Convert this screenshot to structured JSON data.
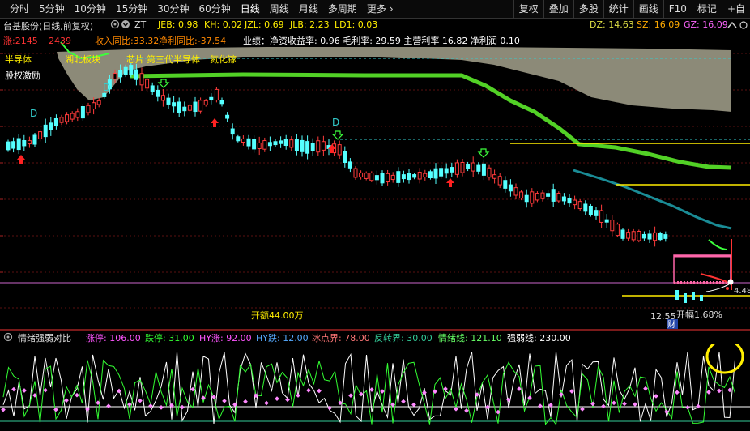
{
  "toolbar": {
    "tabs": [
      {
        "label": "分时"
      },
      {
        "label": "5分钟"
      },
      {
        "label": "10分钟"
      },
      {
        "label": "15分钟"
      },
      {
        "label": "30分钟"
      },
      {
        "label": "60分钟"
      },
      {
        "label": "日线"
      },
      {
        "label": "周线"
      },
      {
        "label": "月线"
      },
      {
        "label": "多周期"
      },
      {
        "label": "更多"
      }
    ],
    "more_arrow": "›",
    "right_buttons": [
      {
        "label": "复权"
      },
      {
        "label": "叠加"
      },
      {
        "label": "多股"
      },
      {
        "label": "统计"
      },
      {
        "label": "画线"
      },
      {
        "label": "F10"
      },
      {
        "label": "标记"
      },
      {
        "label": "+自"
      }
    ]
  },
  "header": {
    "stock_title": "台基股份(日线,前复权)",
    "zt_label": "ZT",
    "indicators": [
      {
        "label": "JEB: 0.98"
      },
      {
        "label": "KH: 0.02"
      },
      {
        "label": "JZL: 0.69"
      },
      {
        "label": "JLB: 2.23"
      },
      {
        "label": "LD1: 0.03"
      }
    ],
    "right_indicators": [
      {
        "label": "DZ: 14.63"
      },
      {
        "label": "SZ: 16.09"
      },
      {
        "label": "GZ: 16.09"
      }
    ]
  },
  "main": {
    "ranks": [
      {
        "label": "涨:2145"
      },
      {
        "label": "2439"
      },
      {
        "label": "收入同比:33.32"
      },
      {
        "label": "净利同比:-37.54"
      }
    ],
    "business_line": "业绩：净资收益率: 0.96 毛利率: 29.59 主营利率 16.82 净利润 0.10",
    "concept_tags": [
      {
        "label": "半导体"
      },
      {
        "label": "湖北板块"
      },
      {
        "label": "芯片"
      },
      {
        "label": "第三代半导体"
      },
      {
        "label": "氮化镓"
      }
    ],
    "equity_tag": "股权激励",
    "volume_label": "开额44.00万",
    "price_label": "12.55",
    "open_label": "开幅1.68%",
    "right_price_label": "4.48",
    "cai_label": "财",
    "d_markers": [
      {
        "label": "D"
      },
      {
        "label": "D"
      },
      {
        "label": "D"
      }
    ],
    "colors": {
      "up": "#ff3b3b",
      "down": "#55ffff",
      "cloud": "#8c8a78",
      "green_line": "#52d126",
      "teal_line": "#1a8c96",
      "yellow_line": "#ffee00"
    }
  },
  "sub": {
    "title": "情绪强弱对比",
    "values": [
      {
        "label": "涨停: 106.00",
        "color": "#ff55ff"
      },
      {
        "label": "跌停: 31.00",
        "color": "#33ff33"
      },
      {
        "label": "HY涨: 92.00",
        "color": "#ff55ff"
      },
      {
        "label": "HY跌: 12.00",
        "color": "#55aaff"
      },
      {
        "label": "冰点界: 78.00",
        "color": "#ff7777"
      },
      {
        "label": "反转界: 30.00",
        "color": "#33cc99"
      },
      {
        "label": "情绪线: 121.10",
        "color": "#66ff66"
      },
      {
        "label": "强弱线: 230.00",
        "color": "#ffffff"
      }
    ]
  }
}
